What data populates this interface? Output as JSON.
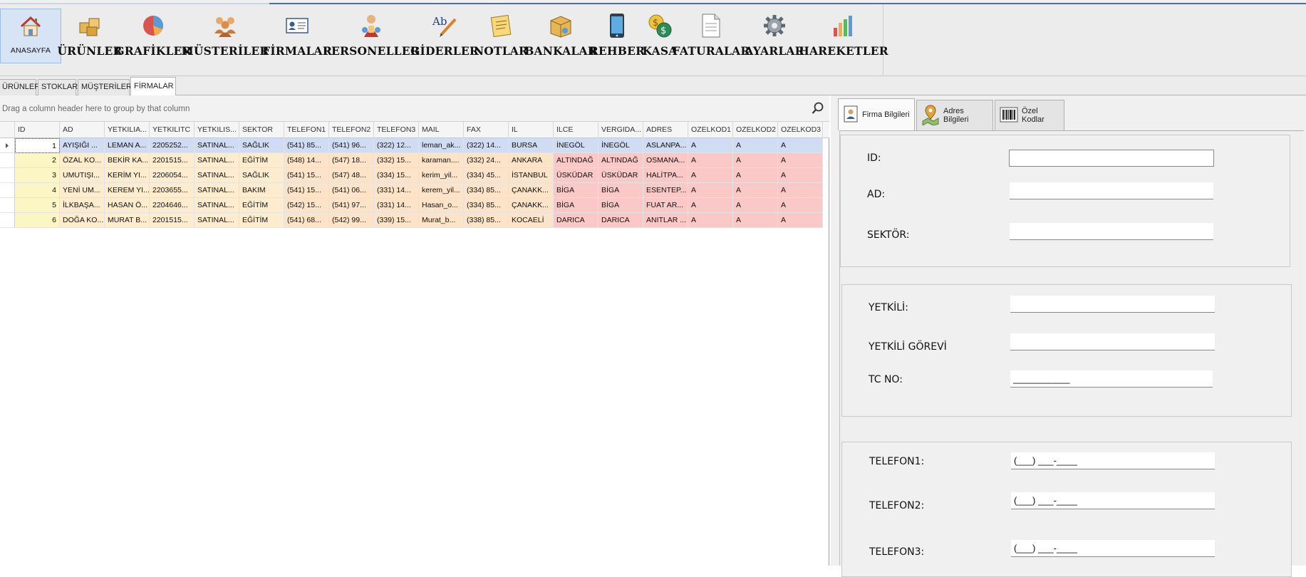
{
  "ribbon": {
    "home": {
      "label": "ANASAYFA",
      "icon": "house-icon"
    },
    "buttons": [
      {
        "label": "ÜRÜNLER",
        "icon": "boxes-icon"
      },
      {
        "label": "GRAFİKLER",
        "icon": "pie-chart-icon"
      },
      {
        "label": "MÜSTERİLER",
        "icon": "people-group-icon"
      },
      {
        "label": "FİRMALAR",
        "icon": "id-card-icon"
      },
      {
        "label": "PERSONELLER",
        "icon": "staff-icon"
      },
      {
        "label": "GİDERLER",
        "icon": "spell-pen-icon"
      },
      {
        "label": "NOTLAR",
        "icon": "notes-icon"
      },
      {
        "label": "BANKALAR",
        "icon": "bank-box-icon"
      },
      {
        "label": "REHBER",
        "icon": "phone-icon"
      },
      {
        "label": "KASA",
        "icon": "money-icon"
      },
      {
        "label": "FATURALAR",
        "icon": "document-icon"
      },
      {
        "label": "AYARLAR",
        "icon": "gear-icon"
      },
      {
        "label": "HAREKETLER",
        "icon": "bar-chart-icon"
      }
    ]
  },
  "tabs": [
    "ÜRÜNLER",
    "STOKLAR",
    "MÜŞTERİLER",
    "FİRMALAR"
  ],
  "active_tab": "FİRMALAR",
  "grid": {
    "group_hint": "Drag a column header here to group by that column",
    "columns": [
      "ID",
      "AD",
      "YETKILIA...",
      "YETKILITC",
      "YETKILIS...",
      "SEKTOR",
      "TELEFON1",
      "TELEFON2",
      "TELEFON3",
      "MAIL",
      "FAX",
      "IL",
      "ILCE",
      "VERGIDA...",
      "ADRES",
      "OZELKOD1",
      "OZELKOD2",
      "OZELKOD3"
    ],
    "rows": [
      [
        "1",
        "AYIŞIĞI ...",
        "LEMAN A...",
        "2205252...",
        "SATINAL...",
        "SAĞLIK",
        "(541) 85...",
        "(541) 96...",
        "(322) 12...",
        "leman_ak...",
        "(322) 14...",
        "BURSA",
        "İNEGÖL",
        "İNEGÖL",
        "ASLANPA...",
        "A",
        "A",
        "A"
      ],
      [
        "2",
        "ÖZAL KO...",
        "BEKİR KA...",
        "2201515...",
        "SATINAL...",
        "EĞİTİM",
        "(548) 14...",
        "(547) 18...",
        "(332) 15...",
        "karaman....",
        "(332) 24...",
        "ANKARA",
        "ALTINDAĞ",
        "ALTINDAĞ",
        "OSMANA...",
        "A",
        "A",
        "A"
      ],
      [
        "3",
        "UMUTIŞI...",
        "KERİM YI...",
        "2206054...",
        "SATINAL...",
        "SAĞLIK",
        "(541) 15...",
        "(547) 48...",
        "(334) 15...",
        "kerim_yil...",
        "(334) 45...",
        "İSTANBUL",
        "ÜSKÜDAR",
        "ÜSKÜDAR",
        "HALİTPA...",
        "A",
        "A",
        "A"
      ],
      [
        "4",
        "YENİ UM...",
        "KEREM YI...",
        "2203655...",
        "SATINAL...",
        "BAKIM",
        "(541) 15...",
        "(541) 06...",
        "(331) 14...",
        "kerem_yil...",
        "(334) 85...",
        "ÇANAKK...",
        "BİGA",
        "BİGA",
        "ESENTEP...",
        "A",
        "A",
        "A"
      ],
      [
        "5",
        "İLKBAŞA...",
        "HASAN Ö...",
        "2204646...",
        "SATINAL...",
        "EĞİTİM",
        "(542) 15...",
        "(541) 97...",
        "(331) 14...",
        "Hasan_o...",
        "(334) 85...",
        "ÇANAKK...",
        "BİGA",
        "BİGA",
        "FUAT AR...",
        "A",
        "A",
        "A"
      ],
      [
        "6",
        "DOĞA KO...",
        "MURAT B...",
        "2201515...",
        "SATINAL...",
        "EĞİTİM",
        "(541) 68...",
        "(542) 99...",
        "(339) 15...",
        "Murat_b...",
        "(338) 85...",
        "KOCAELİ",
        "DARICA",
        "DARICA",
        "ANITLAR ...",
        "A",
        "A",
        "A"
      ]
    ]
  },
  "detail": {
    "tabs": [
      {
        "label": "Firma Bilgileri",
        "icon": "person-card-icon"
      },
      {
        "label": "Adres Bilgileri",
        "icon": "map-pin-icon"
      },
      {
        "label": "Özel Kodlar",
        "icon": "barcode-icon"
      }
    ],
    "fields": {
      "id": {
        "label": "ID:",
        "value": ""
      },
      "ad": {
        "label": "AD:",
        "value": ""
      },
      "sektor": {
        "label": "SEKTÖR:",
        "value": ""
      },
      "yetkili": {
        "label": "YETKİLİ:",
        "value": ""
      },
      "yetkili_gorevi": {
        "label": "YETKİLİ GÖREVİ",
        "value": ""
      },
      "tc_no": {
        "label": "TC NO:",
        "value": "___________"
      },
      "telefon1": {
        "label": "TELEFON1:",
        "value": "(___) ___-____"
      },
      "telefon2": {
        "label": "TELEFON2:",
        "value": "(___) ___-____"
      },
      "telefon3": {
        "label": "TELEFON3:",
        "value": "(___) ___-____"
      }
    }
  },
  "colors": {
    "selected_row": "#cfdcf3",
    "id_column": "#fbf6c4",
    "row_mid": "#fde3c8",
    "row_right": "#fbc8c8"
  }
}
